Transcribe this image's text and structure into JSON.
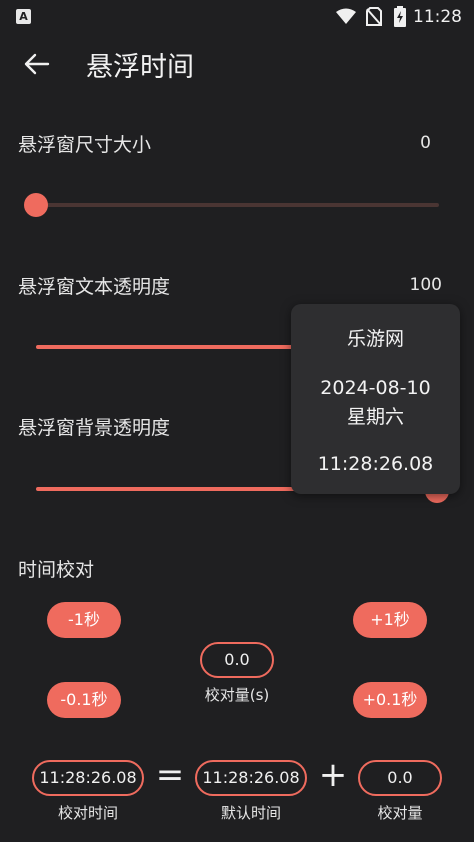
{
  "status_bar": {
    "app_icon": "A",
    "time": "11:28",
    "icons": [
      "wifi-icon",
      "no-sim-icon",
      "battery-charging-icon"
    ]
  },
  "header": {
    "title": "悬浮时间",
    "back_icon": "arrow-left-icon"
  },
  "settings": {
    "size": {
      "label": "悬浮窗尺寸大小",
      "value": "0",
      "slider_fraction": 0.0
    },
    "text_opacity": {
      "label": "悬浮窗文本透明度",
      "value": "100",
      "slider_fraction": 1.0
    },
    "bg_opacity": {
      "label": "悬浮窗背景透明度",
      "slider_fraction": 1.0
    }
  },
  "calibration": {
    "title": "时间校对",
    "minus_1": "-1秒",
    "plus_1": "+1秒",
    "minus_01": "-0.1秒",
    "plus_01": "+0.1秒",
    "offset_value": "0.0",
    "offset_caption": "校对量(s)"
  },
  "equation": {
    "calibrated_time": "11:28:26.08",
    "calibrated_caption": "校对时间",
    "equals": "=",
    "default_time": "11:28:26.08",
    "default_caption": "默认时间",
    "plus": "+",
    "offset": "0.0",
    "offset_caption": "校对量"
  },
  "floating_window": {
    "site": "乐游网",
    "date": "2024-08-10",
    "weekday": "星期六",
    "time": "11:28:26.08"
  },
  "colors": {
    "accent": "#ef6b5e",
    "background": "#1f1f21",
    "overlay": "#2e2e30"
  }
}
